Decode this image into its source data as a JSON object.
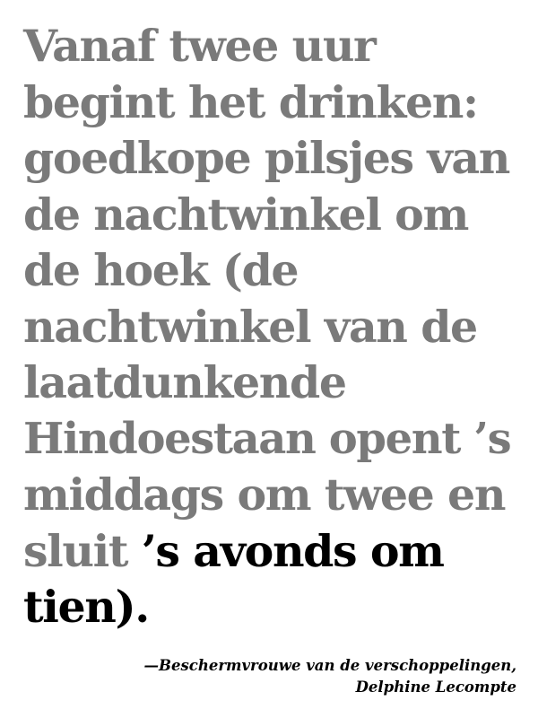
{
  "quote": {
    "lines_gray": [
      "Vanaf twee uur",
      "begint het drinken:",
      "goedkope pilsjes van",
      "de nachtwinkel om",
      "de hoek (de",
      "nachtwinkel van de",
      "laatdunkende",
      "Hindoestaan opent ’s",
      "middags om twee en"
    ],
    "line10_gray": "sluit ",
    "line10_black": "’s avonds om",
    "line11_black": "tien)."
  },
  "attribution": {
    "line1": "—Beschermvrouwe van de verschoppelingen,",
    "line2": "Delphine Lecompte"
  },
  "colors": {
    "gray_text": "#7a7a7a",
    "black_text": "#000000"
  }
}
